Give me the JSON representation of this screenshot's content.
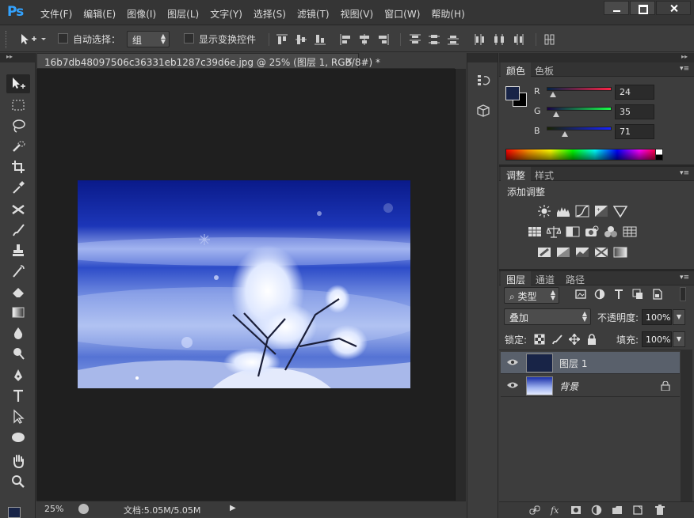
{
  "app": {
    "logo": "Ps"
  },
  "menu": [
    "文件(F)",
    "编辑(E)",
    "图像(I)",
    "图层(L)",
    "文字(Y)",
    "选择(S)",
    "滤镜(T)",
    "视图(V)",
    "窗口(W)",
    "帮助(H)"
  ],
  "options": {
    "auto_select_label": "自动选择：",
    "auto_select_target": "组",
    "show_transform_label": "显示变换控件"
  },
  "tools": [
    "move-tool",
    "marquee-tool",
    "lasso-tool",
    "quick-select-tool",
    "crop-tool",
    "eyedropper-tool",
    "healing-tool",
    "brush-tool",
    "stamp-tool",
    "history-brush-tool",
    "eraser-tool",
    "gradient-tool",
    "blur-tool",
    "dodge-tool",
    "pen-tool",
    "type-tool",
    "path-select-tool",
    "shape-tool",
    "hand-tool",
    "zoom-tool"
  ],
  "document": {
    "tab_title": "16b7db48097506c36331eb1287c39d6e.jpg @ 25% (图层 1, RGB/8#) *",
    "zoom": "25%",
    "size": "文档:5.05M/5.05M"
  },
  "color_panel": {
    "tabs": [
      "颜色",
      "色板"
    ],
    "foreground": "#182447",
    "background": "#000000",
    "channels": [
      {
        "label": "R",
        "value": "24"
      },
      {
        "label": "G",
        "value": "35"
      },
      {
        "label": "B",
        "value": "71"
      }
    ]
  },
  "adjust_panel": {
    "tabs": [
      "调整",
      "样式"
    ],
    "title": "添加调整"
  },
  "layers_panel": {
    "tabs": [
      "图层",
      "通道",
      "路径"
    ],
    "filter_kind": "类型",
    "blend_mode": "叠加",
    "opacity_label": "不透明度:",
    "opacity": "100%",
    "lock_label": "锁定:",
    "fill_label": "填充:",
    "fill": "100%",
    "layers": [
      {
        "name": "图层 1",
        "selected": true,
        "locked": false
      },
      {
        "name": "背景",
        "selected": false,
        "locked": true
      }
    ]
  }
}
